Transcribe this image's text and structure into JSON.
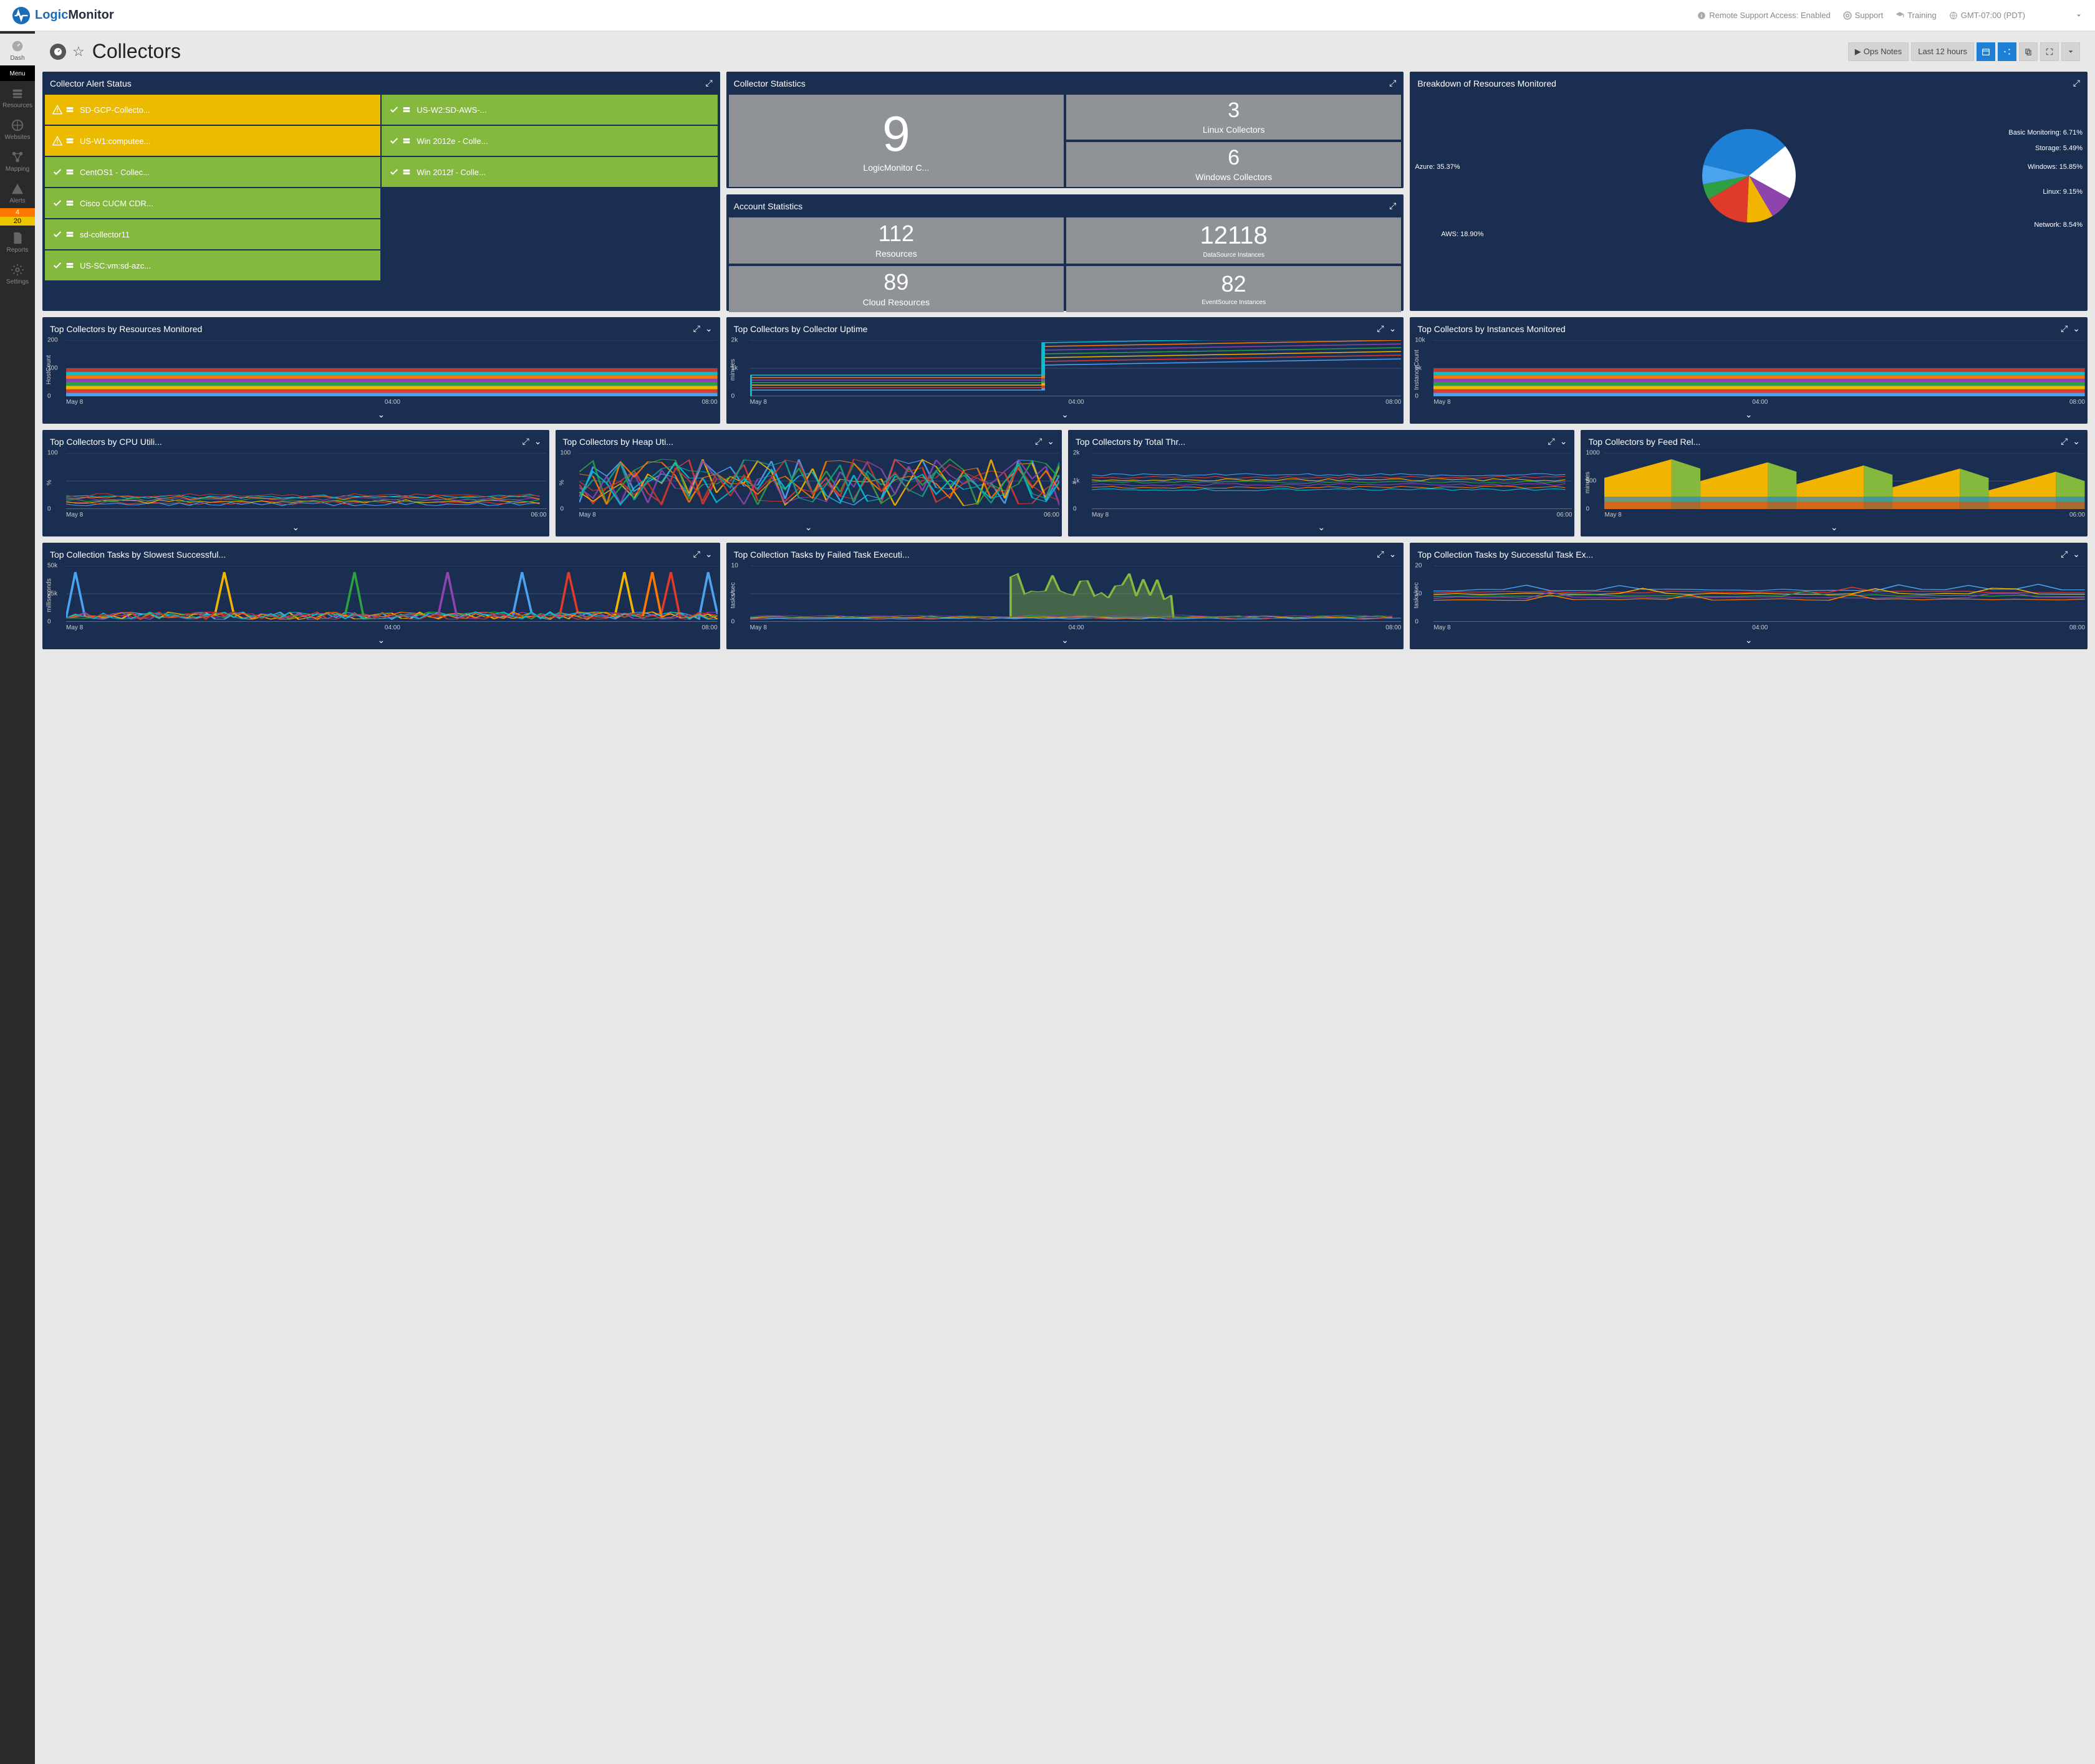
{
  "brand": {
    "name1": "Logic",
    "name2": "Monitor"
  },
  "header": {
    "remote": "Remote Support Access: Enabled",
    "support": "Support",
    "training": "Training",
    "tz": "GMT-07:00 (PDT)"
  },
  "nav": {
    "items": [
      {
        "label": "Dash"
      },
      {
        "label": "Menu"
      },
      {
        "label": "Resources"
      },
      {
        "label": "Websites"
      },
      {
        "label": "Mapping"
      },
      {
        "label": "Alerts"
      },
      {
        "label": "Reports"
      },
      {
        "label": "Settings"
      }
    ],
    "alert_counts": {
      "orange": "4",
      "yellow": "20"
    }
  },
  "page": {
    "title": "Collectors",
    "ops_notes": "Ops Notes",
    "timerange": "Last 12 hours"
  },
  "widgets": {
    "alert_status": {
      "title": "Collector Alert Status",
      "tiles": [
        {
          "status": "warn",
          "label": "SD-GCP-Collecto..."
        },
        {
          "status": "ok",
          "label": "US-W2:SD-AWS-..."
        },
        {
          "status": "warn",
          "label": "US-W1:computee..."
        },
        {
          "status": "ok",
          "label": "Win 2012e - Colle..."
        },
        {
          "status": "ok",
          "label": "CentOS1 - Collec..."
        },
        {
          "status": "ok",
          "label": "Win 2012f - Colle..."
        },
        {
          "status": "ok",
          "label": "Cisco CUCM CDR..."
        },
        {
          "status": "ok",
          "label": "sd-collector11"
        },
        {
          "status": "ok",
          "label": "US-SC:vm:sd-azc..."
        }
      ]
    },
    "collector_stats": {
      "title": "Collector Statistics",
      "big": {
        "n": "9",
        "l": "LogicMonitor C..."
      },
      "r1": {
        "n": "3",
        "l": "Linux Collectors"
      },
      "r2": {
        "n": "6",
        "l": "Windows Collectors"
      }
    },
    "account_stats": {
      "title": "Account Statistics",
      "a": {
        "n": "112",
        "l": "Resources"
      },
      "b": {
        "n": "12118",
        "l": "DataSource Instances"
      },
      "c": {
        "n": "89",
        "l": "Cloud Resources"
      },
      "d": {
        "n": "82",
        "l": "EventSource Instances"
      }
    },
    "breakdown": {
      "title": "Breakdown of Resources Monitored",
      "labels": {
        "azure": "Azure: 35.37%",
        "aws": "AWS: 18.90%",
        "basic": "Basic Monitoring: 6.71%",
        "storage": "Storage: 5.49%",
        "windows": "Windows: 15.85%",
        "linux": "Linux: 9.15%",
        "network": "Network: 8.54%"
      }
    },
    "row2": [
      {
        "title": "Top Collectors by Resources Monitored",
        "ylabel": "HostCount",
        "ymax": "200",
        "ymid": "100",
        "x": [
          "May 8",
          "04:00",
          "08:00"
        ]
      },
      {
        "title": "Top Collectors by Collector Uptime",
        "ylabel": "minutes",
        "ymax": "2k",
        "ymid": "1k",
        "x": [
          "May 8",
          "04:00",
          "08:00"
        ]
      },
      {
        "title": "Top Collectors by Instances Monitored",
        "ylabel": "InstanceCount",
        "ymax": "10k",
        "ymid": "5k",
        "x": [
          "May 8",
          "04:00",
          "08:00"
        ]
      }
    ],
    "row3": [
      {
        "title": "Top Collectors by CPU Utili...",
        "ylabel": "%",
        "ymax": "100",
        "x": [
          "May 8",
          "06:00"
        ]
      },
      {
        "title": "Top Collectors by Heap Uti...",
        "ylabel": "%",
        "ymax": "100",
        "x": [
          "May 8",
          "06:00"
        ]
      },
      {
        "title": "Top Collectors by Total Thr...",
        "ylabel": "#",
        "ymax": "2k",
        "ymid": "1k",
        "x": [
          "May 8",
          "06:00"
        ]
      },
      {
        "title": "Top Collectors by Feed Rel...",
        "ylabel": "minutes",
        "ymax": "1000",
        "ymid": "500",
        "x": [
          "May 8",
          "06:00"
        ]
      }
    ],
    "row4": [
      {
        "title": "Top Collection Tasks by Slowest Successful...",
        "ylabel": "milliseconds",
        "ymax": "50k",
        "ymid": "25k",
        "x": [
          "May 8",
          "04:00",
          "08:00"
        ]
      },
      {
        "title": "Top Collection Tasks by Failed Task Executi...",
        "ylabel": "tasks/sec",
        "ymax": "10",
        "ymid": "5",
        "x": [
          "May 8",
          "04:00",
          "08:00"
        ]
      },
      {
        "title": "Top Collection Tasks by Successful Task Ex...",
        "ylabel": "tasks/sec",
        "ymax": "20",
        "ymid": "10",
        "x": [
          "May 8",
          "04:00",
          "08:00"
        ]
      }
    ]
  },
  "chart_data": {
    "type": "pie",
    "title": "Breakdown of Resources Monitored",
    "series": [
      {
        "name": "Azure",
        "value": 35.37,
        "color": "#1d7fd6"
      },
      {
        "name": "AWS",
        "value": 18.9,
        "color": "#ffffff"
      },
      {
        "name": "Network",
        "value": 8.54,
        "color": "#8e44ad"
      },
      {
        "name": "Linux",
        "value": 9.15,
        "color": "#f1b400"
      },
      {
        "name": "Windows",
        "value": 15.85,
        "color": "#e03a2d"
      },
      {
        "name": "Storage",
        "value": 5.49,
        "color": "#2ea043"
      },
      {
        "name": "Basic Monitoring",
        "value": 6.71,
        "color": "#4aa3ef"
      }
    ]
  }
}
